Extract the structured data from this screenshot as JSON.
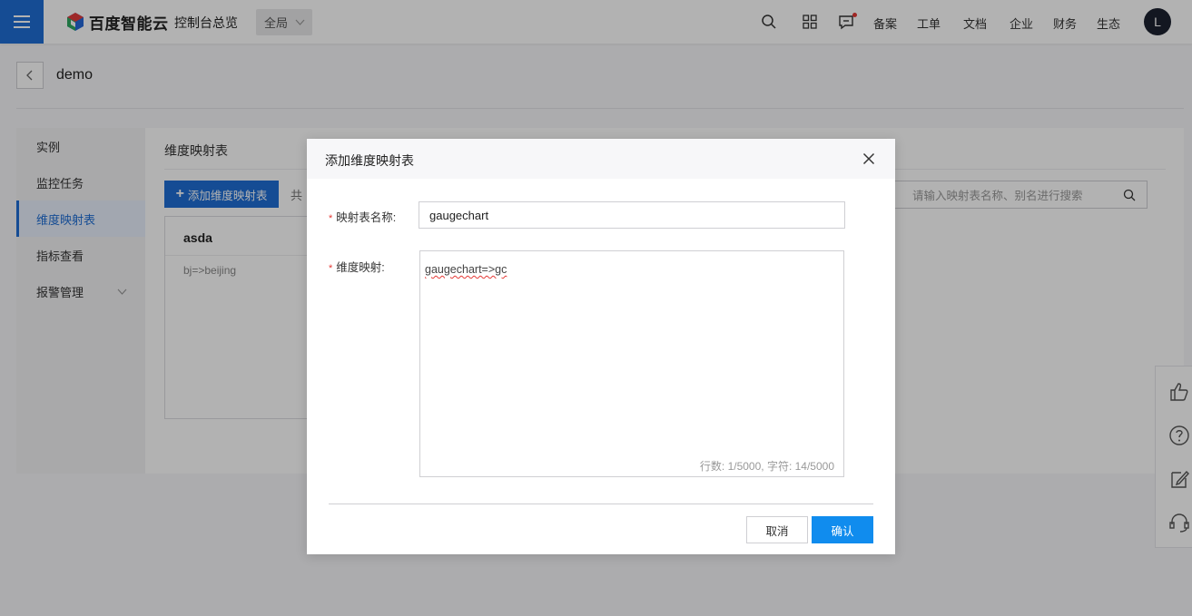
{
  "topbar": {
    "brand": "百度智能云",
    "console": "控制台总览",
    "region": "全局",
    "links": [
      "备案",
      "工单",
      "文档",
      "企业",
      "财务",
      "生态"
    ],
    "avatar": "L"
  },
  "page": {
    "title": "demo"
  },
  "sidebar": {
    "items": [
      {
        "label": "实例"
      },
      {
        "label": "监控任务"
      },
      {
        "label": "维度映射表"
      },
      {
        "label": "指标查看"
      },
      {
        "label": "报警管理"
      }
    ]
  },
  "content": {
    "title": "维度映射表",
    "add_button": "添加维度映射表",
    "total_prefix": "共",
    "search_placeholder": "请输入映射表名称、别名进行搜索",
    "card": {
      "name": "asda",
      "mapping": "bj=>beijing"
    }
  },
  "dialog": {
    "title": "添加维度映射表",
    "name_label": "映射表名称:",
    "name_value": "gaugechart",
    "mapping_label": "维度映射:",
    "mapping_value": "gaugechart=>gc",
    "counter": "行数: 1/5000, 字符: 14/5000",
    "cancel": "取消",
    "confirm": "确认"
  },
  "colors": {
    "accent": "#1f6ed4",
    "confirm": "#108cee",
    "required": "#e53935"
  }
}
